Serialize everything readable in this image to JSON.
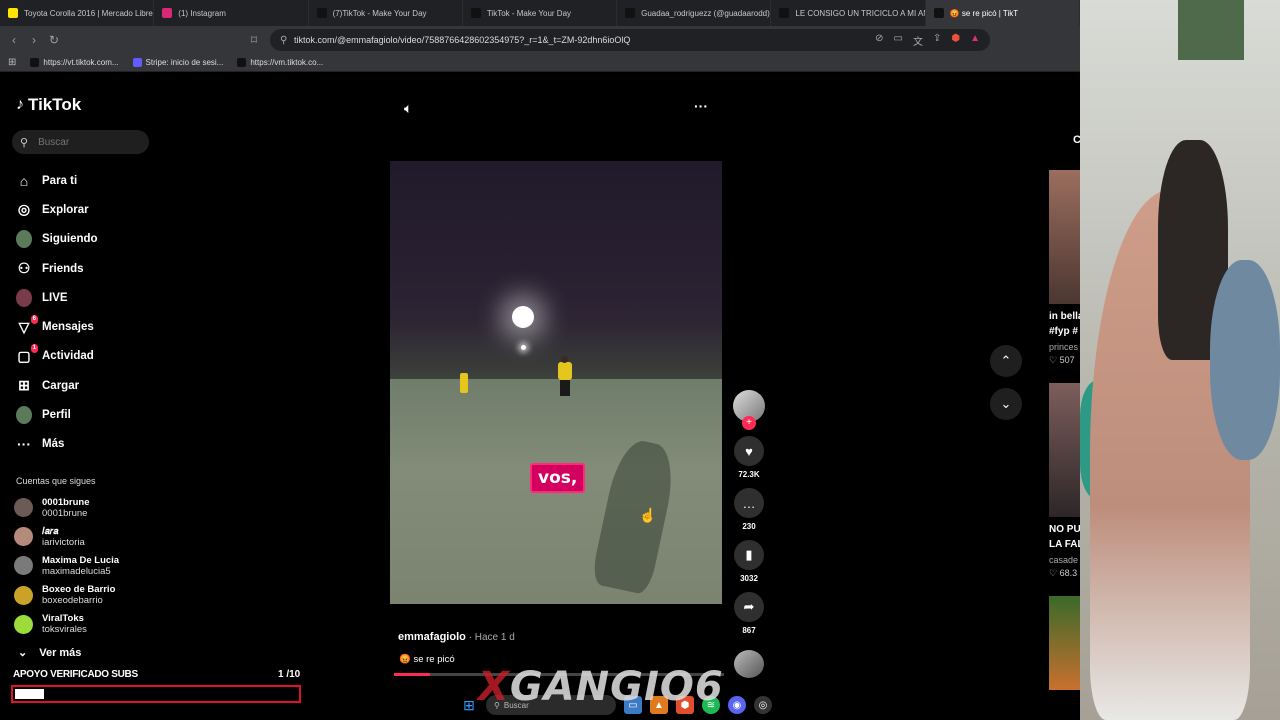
{
  "browser": {
    "tabs": [
      {
        "title": "Toyota Corolla 2016 | Mercado Libre",
        "icon": "mercadolibre-icon"
      },
      {
        "title": "(1) Instagram",
        "icon": "instagram-icon"
      },
      {
        "title": "(7)TikTok - Make Your Day",
        "icon": "tiktok-icon"
      },
      {
        "title": "TikTok - Make Your Day",
        "icon": "tiktok-icon"
      },
      {
        "title": "Guadaa_rodriguezz (@guadaarodd)",
        "icon": "tiktok-icon"
      },
      {
        "title": "LE CONSIGO UN TRICICLO A MI AM",
        "icon": "tiktok-icon"
      },
      {
        "title": "😡 se re picó | TikT",
        "icon": "tiktok-icon",
        "active": true
      }
    ],
    "url": "tiktok.com/@emmafagiolo/video/7588766428602354975?_r=1&_t=ZM-92dhn6ioOlQ",
    "bookmarks": [
      "https://vt.tiktok.com...",
      "Stripe: inicio de sesi...",
      "https://vm.tiktok.co..."
    ]
  },
  "sidebar": {
    "logo": "TikTok",
    "search_placeholder": "Buscar",
    "nav": [
      {
        "label": "Para ti",
        "icon": "home-icon"
      },
      {
        "label": "Explorar",
        "icon": "compass-icon"
      },
      {
        "label": "Siguiendo",
        "icon": "following-avatar-icon"
      },
      {
        "label": "Friends",
        "icon": "friends-icon"
      },
      {
        "label": "LIVE",
        "icon": "live-icon"
      },
      {
        "label": "Mensajes",
        "icon": "messages-icon",
        "badge": "6"
      },
      {
        "label": "Actividad",
        "icon": "activity-icon",
        "badge": "1"
      },
      {
        "label": "Cargar",
        "icon": "upload-icon"
      },
      {
        "label": "Perfil",
        "icon": "profile-avatar-icon"
      },
      {
        "label": "Más",
        "icon": "more-dots-icon"
      }
    ],
    "following_title": "Cuentas que sigues",
    "following": [
      {
        "name": "0001brune",
        "username": "0001brune",
        "color": "#6b5a55"
      },
      {
        "name": "𝐼𝑎𝑟𝑎",
        "username": "iarivictoria",
        "color": "#b48a7a"
      },
      {
        "name": "Maxima De Lucia",
        "username": "maximadelucia5",
        "color": "#7a7a7a"
      },
      {
        "name": "Boxeo de Barrio",
        "username": "boxeodebarrio",
        "color": "#c9a227"
      },
      {
        "name": "ViralToks",
        "username": "toksvirales",
        "color": "#9bdc3a"
      }
    ],
    "ver_mas": "Ver más"
  },
  "stream_overlay": {
    "label": "APOYO VERIFICADO SUBS",
    "count": "1 /10",
    "progress": 0.1
  },
  "video": {
    "caption_overlay": "vos,",
    "author": "emmafagiolo",
    "time": " · Hace 1 d",
    "description": "😡 se re picó",
    "progress": 0.11,
    "likes": "72.3K",
    "comments": "230",
    "saves": "3032",
    "shares": "867"
  },
  "right_strip": {
    "header": "C",
    "item1_lines": [
      "in bella",
      "#fyp #",
      "princes",
      "♡ 507"
    ],
    "item2_lines": [
      "NO PU",
      "LA FAL",
      "casade",
      "♡ 68.3"
    ]
  },
  "taskbar": {
    "search": "Buscar"
  },
  "watermark": "GANGIO6",
  "colors": {
    "accent": "#fe2c55",
    "overlay_red": "#e0112b",
    "caption_bg": "#d4005f"
  }
}
